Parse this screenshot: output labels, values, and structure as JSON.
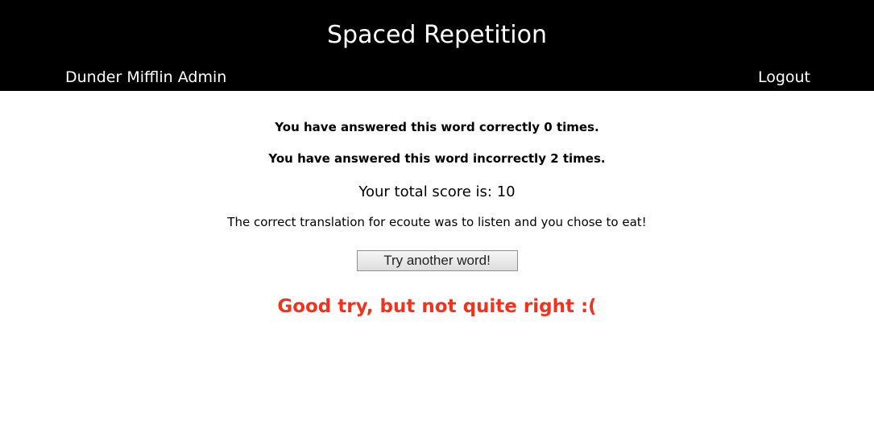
{
  "header": {
    "title": "Spaced Repetition",
    "user_name": "Dunder Mifflin Admin",
    "logout_label": "Logout"
  },
  "main": {
    "correct_count_text": "You have answered this word correctly 0 times.",
    "incorrect_count_text": "You have answered this word incorrectly 2 times.",
    "total_score_text": "Your total score is: 10",
    "feedback_text": "The correct translation for ecoute was to listen and you chose to eat!",
    "try_another_label": "Try another word!",
    "result_message": "Good try, but not quite right :("
  },
  "colors": {
    "header_bg": "#000000",
    "result_message": "#f0321e"
  }
}
